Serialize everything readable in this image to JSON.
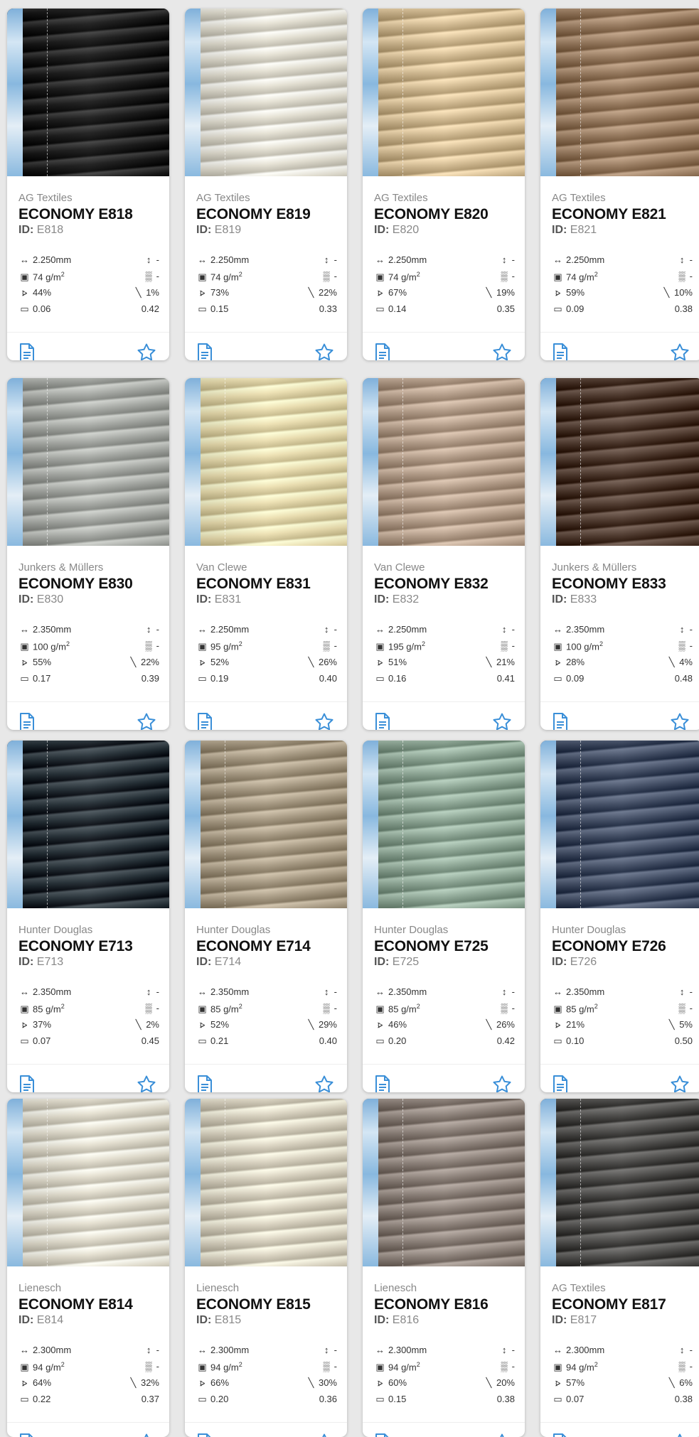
{
  "icons": {
    "width": "width-arrows-icon",
    "height": "height-arrow-icon",
    "weight": "weight-icon",
    "pattern": "pattern-icon",
    "openness": "openness-icon",
    "transmission": "transmission-icon",
    "absorption": "absorption-icon",
    "document": "document-icon",
    "favorite": "star-icon"
  },
  "id_label": "ID:",
  "products": [
    {
      "brand": "AG Textiles",
      "name": "ECONOMY E818",
      "id": "E818",
      "width": "2.250mm",
      "height": "-",
      "weight": "74 g/m",
      "pattern": "-",
      "openness": "44%",
      "transmission": "1%",
      "absorption": "0.06",
      "reflection": "0.42",
      "color": "#141414"
    },
    {
      "brand": "AG Textiles",
      "name": "ECONOMY E819",
      "id": "E819",
      "width": "2.250mm",
      "height": "-",
      "weight": "74 g/m",
      "pattern": "-",
      "openness": "73%",
      "transmission": "22%",
      "absorption": "0.15",
      "reflection": "0.33",
      "color": "#e6e2d4"
    },
    {
      "brand": "AG Textiles",
      "name": "ECONOMY E820",
      "id": "E820",
      "width": "2.250mm",
      "height": "-",
      "weight": "74 g/m",
      "pattern": "-",
      "openness": "67%",
      "transmission": "19%",
      "absorption": "0.14",
      "reflection": "0.35",
      "color": "#d6bd92"
    },
    {
      "brand": "AG Textiles",
      "name": "ECONOMY E821",
      "id": "E821",
      "width": "2.250mm",
      "height": "-",
      "weight": "74 g/m",
      "pattern": "-",
      "openness": "59%",
      "transmission": "10%",
      "absorption": "0.09",
      "reflection": "0.38",
      "color": "#9a7b5e"
    },
    {
      "brand": "Junkers & Müllers",
      "name": "ECONOMY E830",
      "id": "E830",
      "width": "2.350mm",
      "height": "-",
      "weight": "100 g/m",
      "pattern": "-",
      "openness": "55%",
      "transmission": "22%",
      "absorption": "0.17",
      "reflection": "0.39",
      "color": "#a8aba6"
    },
    {
      "brand": "Van Clewe",
      "name": "ECONOMY E831",
      "id": "E831",
      "width": "2.250mm",
      "height": "-",
      "weight": "95 g/m",
      "pattern": "-",
      "openness": "52%",
      "transmission": "26%",
      "absorption": "0.19",
      "reflection": "0.40",
      "color": "#ede0b0"
    },
    {
      "brand": "Van Clewe",
      "name": "ECONOMY E832",
      "id": "E832",
      "width": "2.250mm",
      "height": "-",
      "weight": "195 g/m",
      "pattern": "-",
      "openness": "51%",
      "transmission": "21%",
      "absorption": "0.16",
      "reflection": "0.41",
      "color": "#b79f8a"
    },
    {
      "brand": "Junkers & Müllers",
      "name": "ECONOMY E833",
      "id": "E833",
      "width": "2.350mm",
      "height": "-",
      "weight": "100 g/m",
      "pattern": "-",
      "openness": "28%",
      "transmission": "4%",
      "absorption": "0.09",
      "reflection": "0.48",
      "color": "#4a3428"
    },
    {
      "brand": "Hunter Douglas",
      "name": "ECONOMY E713",
      "id": "E713",
      "width": "2.350mm",
      "height": "-",
      "weight": "85 g/m",
      "pattern": "-",
      "openness": "37%",
      "transmission": "2%",
      "absorption": "0.07",
      "reflection": "0.45",
      "color": "#1f2a31"
    },
    {
      "brand": "Hunter Douglas",
      "name": "ECONOMY E714",
      "id": "E714",
      "width": "2.350mm",
      "height": "-",
      "weight": "85 g/m",
      "pattern": "-",
      "openness": "52%",
      "transmission": "29%",
      "absorption": "0.21",
      "reflection": "0.40",
      "color": "#a89a82"
    },
    {
      "brand": "Hunter Douglas",
      "name": "ECONOMY E725",
      "id": "E725",
      "width": "2.350mm",
      "height": "-",
      "weight": "85 g/m",
      "pattern": "-",
      "openness": "46%",
      "transmission": "26%",
      "absorption": "0.20",
      "reflection": "0.42",
      "color": "#8ea896"
    },
    {
      "brand": "Hunter Douglas",
      "name": "ECONOMY E726",
      "id": "E726",
      "width": "2.350mm",
      "height": "-",
      "weight": "85 g/m",
      "pattern": "-",
      "openness": "21%",
      "transmission": "5%",
      "absorption": "0.10",
      "reflection": "0.50",
      "color": "#3e4a62"
    },
    {
      "brand": "Lienesch",
      "name": "ECONOMY E814",
      "id": "E814",
      "width": "2.300mm",
      "height": "-",
      "weight": "94 g/m",
      "pattern": "-",
      "openness": "64%",
      "transmission": "32%",
      "absorption": "0.22",
      "reflection": "0.37",
      "color": "#e5e0d0"
    },
    {
      "brand": "Lienesch",
      "name": "ECONOMY E815",
      "id": "E815",
      "width": "2.300mm",
      "height": "-",
      "weight": "94 g/m",
      "pattern": "-",
      "openness": "66%",
      "transmission": "30%",
      "absorption": "0.20",
      "reflection": "0.36",
      "color": "#ded7c4"
    },
    {
      "brand": "Lienesch",
      "name": "ECONOMY E816",
      "id": "E816",
      "width": "2.300mm",
      "height": "-",
      "weight": "94 g/m",
      "pattern": "-",
      "openness": "60%",
      "transmission": "20%",
      "absorption": "0.15",
      "reflection": "0.38",
      "color": "#8d8179"
    },
    {
      "brand": "AG Textiles",
      "name": "ECONOMY E817",
      "id": "E817",
      "width": "2.300mm",
      "height": "-",
      "weight": "94 g/m",
      "pattern": "-",
      "openness": "57%",
      "transmission": "6%",
      "absorption": "0.07",
      "reflection": "0.38",
      "color": "#494846"
    }
  ]
}
